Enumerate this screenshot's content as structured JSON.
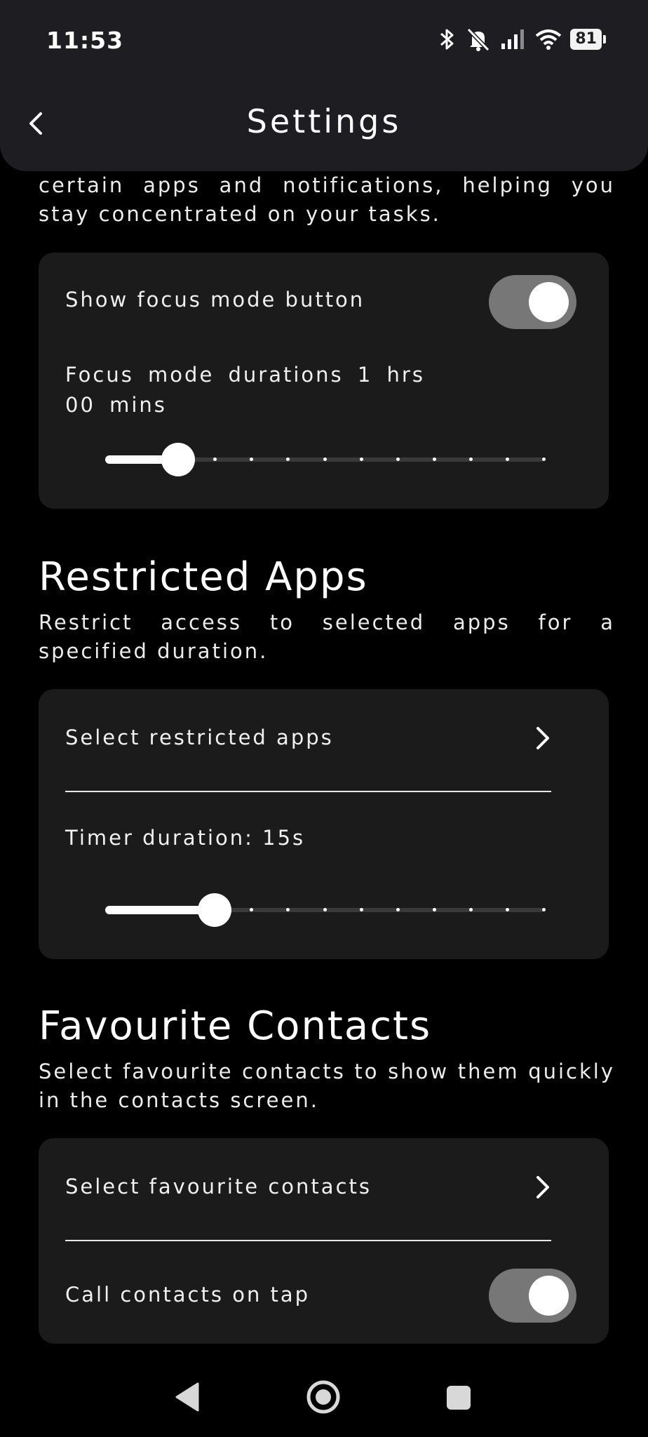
{
  "status": {
    "time": "11:53",
    "battery": "81"
  },
  "header": {
    "title": "Settings"
  },
  "focus": {
    "description": "certain apps and notifications, helping you stay concentrated on your tasks.",
    "show_button_label": "Show focus mode button",
    "show_button_on": true,
    "duration_label": "Focus mode durations 1 hrs 00 mins",
    "duration_slider": {
      "value_fraction": 0.167,
      "steps": 12
    }
  },
  "restricted": {
    "title": "Restricted Apps",
    "description": "Restrict access to selected apps for a specified duration.",
    "select_label": "Select restricted apps",
    "timer_label": "Timer duration:  15s",
    "timer_slider": {
      "value_fraction": 0.25,
      "steps": 12
    }
  },
  "favourites": {
    "title": "Favourite Contacts",
    "description": "Select favourite contacts to show them quickly in the contacts screen.",
    "select_label": "Select favourite contacts",
    "call_label": "Call contacts on tap",
    "call_on": true
  },
  "icons": {
    "back": "chevron-left-icon",
    "nav_back": "triangle-back-icon",
    "nav_home": "circle-home-icon",
    "nav_recents": "square-recents-icon"
  },
  "colors": {
    "background": "#000000",
    "card": "#1b1b1b",
    "appbar": "#1e1e22",
    "toggle_track": "#777777"
  }
}
